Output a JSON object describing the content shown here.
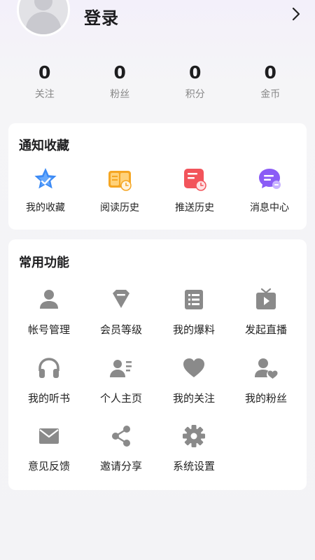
{
  "header": {
    "login_label": "登录"
  },
  "stats": [
    {
      "value": "0",
      "label": "关注"
    },
    {
      "value": "0",
      "label": "粉丝"
    },
    {
      "value": "0",
      "label": "积分"
    },
    {
      "value": "0",
      "label": "金币"
    }
  ],
  "notifications": {
    "title": "通知收藏",
    "items": [
      {
        "label": "我的收藏",
        "icon": "star-icon"
      },
      {
        "label": "阅读历史",
        "icon": "book-history-icon"
      },
      {
        "label": "推送历史",
        "icon": "push-history-icon"
      },
      {
        "label": "消息中心",
        "icon": "message-icon"
      }
    ]
  },
  "functions": {
    "title": "常用功能",
    "items": [
      {
        "label": "帐号管理",
        "icon": "user-icon"
      },
      {
        "label": "会员等级",
        "icon": "diamond-icon"
      },
      {
        "label": "我的爆料",
        "icon": "list-icon"
      },
      {
        "label": "发起直播",
        "icon": "tv-play-icon"
      },
      {
        "label": "我的听书",
        "icon": "headphones-icon"
      },
      {
        "label": "个人主页",
        "icon": "profile-card-icon"
      },
      {
        "label": "我的关注",
        "icon": "heart-icon"
      },
      {
        "label": "我的粉丝",
        "icon": "user-heart-icon"
      },
      {
        "label": "意见反馈",
        "icon": "mail-icon"
      },
      {
        "label": "邀请分享",
        "icon": "share-icon"
      },
      {
        "label": "系统设置",
        "icon": "gear-icon"
      }
    ]
  },
  "colors": {
    "icon_gray": "#8a8a8a",
    "star_blue": "#3d8bf5",
    "book_orange": "#f5a623",
    "push_red": "#f2545b",
    "message_purple": "#8b5cf6"
  }
}
